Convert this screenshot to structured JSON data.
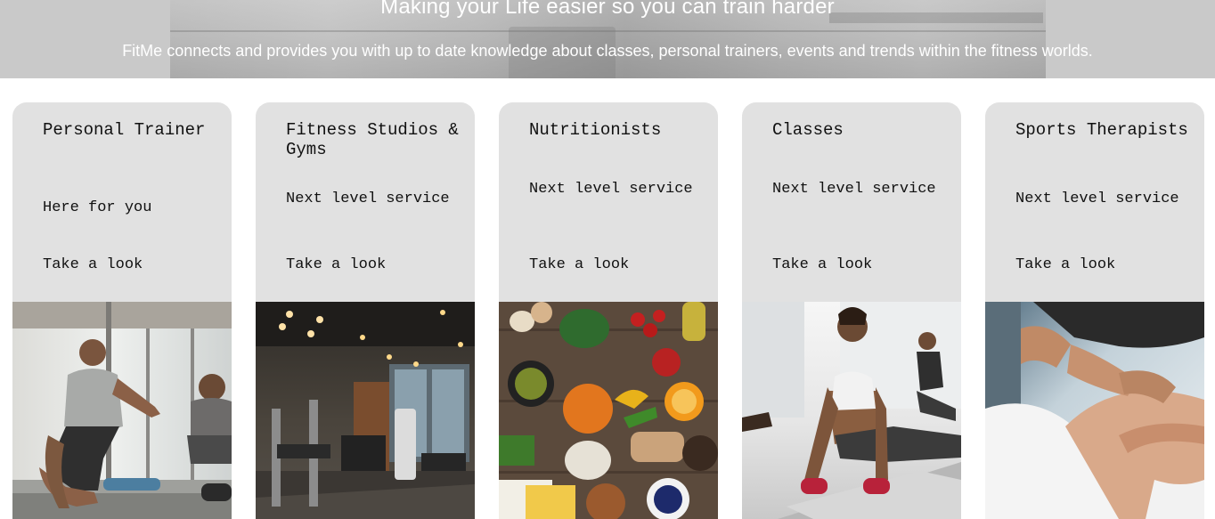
{
  "hero": {
    "title": "Making your Life easier so you can train harder",
    "subtitle": "FitMe connects and provides you with up to date knowledge about classes, personal trainers, events and trends within the fitness worlds."
  },
  "cards": [
    {
      "title": "Personal Trainer",
      "subtitle": "Here for you",
      "link_label": "Take a look",
      "image": "personal-trainer-photo"
    },
    {
      "title": "Fitness Studios & Gyms",
      "subtitle": "Next level service",
      "link_label": "Take a look",
      "image": "gym-interior-photo"
    },
    {
      "title": "Nutritionists",
      "subtitle": "Next level service",
      "link_label": "Take a look",
      "image": "healthy-food-photo"
    },
    {
      "title": "Classes",
      "subtitle": "Next level service",
      "link_label": "Take a look",
      "image": "yoga-class-photo"
    },
    {
      "title": "Sports Therapists",
      "subtitle": "Next level service",
      "link_label": "Take a look",
      "image": "massage-therapy-photo"
    }
  ],
  "colors": {
    "card_background": "#e1e1e1",
    "hero_text": "#ffffff",
    "card_text": "#111111"
  }
}
